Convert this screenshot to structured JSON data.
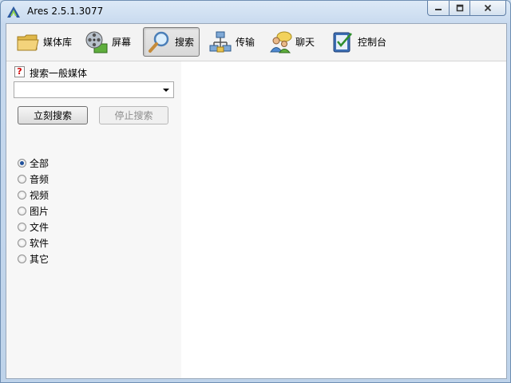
{
  "window": {
    "title": "Ares 2.5.1.3077"
  },
  "caption_buttons": {
    "minimize": "minimize-icon",
    "maximize": "maximize-icon",
    "close": "close-icon"
  },
  "toolbar": {
    "items": [
      {
        "label": "媒体库",
        "icon": "folder-icon",
        "active": false
      },
      {
        "label": "屏幕",
        "icon": "film-reel-icon",
        "active": false
      },
      {
        "label": "搜索",
        "icon": "magnifier-icon",
        "active": true
      },
      {
        "label": "传输",
        "icon": "network-transfer-icon",
        "active": false
      },
      {
        "label": "聊天",
        "icon": "chat-users-icon",
        "active": false
      },
      {
        "label": "控制台",
        "icon": "control-panel-icon",
        "active": false
      }
    ]
  },
  "search": {
    "help_glyph": "?",
    "title": "搜索一般媒体",
    "query_value": "",
    "search_button": "立刻搜索",
    "stop_button": "停止搜索",
    "selected_type": "全部",
    "types": [
      "全部",
      "音频",
      "视频",
      "图片",
      "文件",
      "软件",
      "其它"
    ]
  },
  "colors": {
    "accent": "#1f4f9a",
    "titlebar": "#c7d9ee",
    "toolbar_bg": "#f3f3f3",
    "left_pane": "#f7f7f7",
    "disabled_text": "#8d8d8d"
  }
}
